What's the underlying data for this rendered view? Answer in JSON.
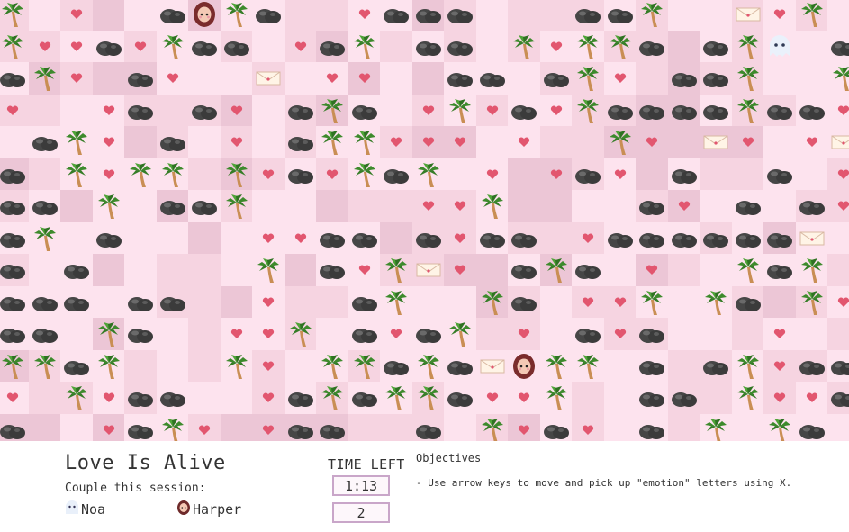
{
  "game": {
    "colors": {
      "floor_light": "#fde3ee",
      "floor_mid": "#f6d4e1",
      "floor_dark": "#ecc6d6",
      "heart": "#e2566f",
      "rock": "#464646",
      "palm_leaf": "#3d8a2c",
      "palm_trunk": "#c98e54",
      "letter": "#fff4e6"
    },
    "icons": [
      "heart-icon",
      "rock-icon",
      "palm-tree-icon",
      "letter-icon",
      "girl-avatar-icon",
      "ghost-avatar-icon"
    ]
  },
  "hud": {
    "title": "Love Is Alive",
    "couple_label": "Couple this session:",
    "player1_name": "Noa",
    "player2_name": "Harper",
    "time_label": "TIME LEFT",
    "time_value": "1:13",
    "score_value": "2",
    "objectives_title": "Objectives",
    "objectives_text": "- Use arrow keys to move and pick up \"emotion\" letters using X."
  }
}
